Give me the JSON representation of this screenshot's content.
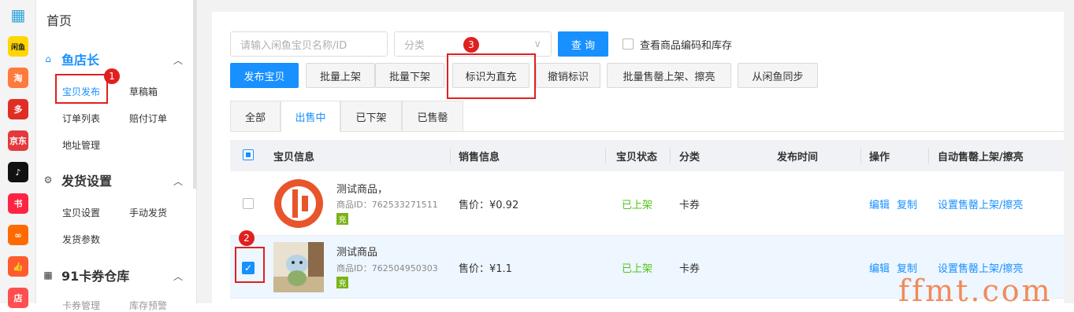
{
  "rail": {
    "icons": [
      {
        "name": "apps-grid-icon",
        "text": "",
        "color": "#2fa4d8"
      },
      {
        "name": "xianyu-icon",
        "text": "闲鱼",
        "color": "#ffd600"
      },
      {
        "name": "taobao-icon",
        "text": "淘",
        "color": "#ff7a3d"
      },
      {
        "name": "pinduoduo-icon",
        "text": "多",
        "color": "#e02e24"
      },
      {
        "name": "jingdong-icon",
        "text": "京东",
        "color": "#e4393c"
      },
      {
        "name": "douyin-icon",
        "text": "♪",
        "color": "#111111"
      },
      {
        "name": "xiaohongshu-icon",
        "text": "书",
        "color": "#ff2442"
      },
      {
        "name": "kuaishou-icon",
        "text": "∞",
        "color": "#ff6a00"
      },
      {
        "name": "thumb-icon",
        "text": "👍",
        "color": "#ff5b2e"
      },
      {
        "name": "store-icon",
        "text": "店",
        "color": "#ff4f4f"
      }
    ]
  },
  "nav": {
    "home": "首页",
    "sec1": {
      "title": "鱼店长",
      "items": [
        "宝贝发布",
        "草稿箱",
        "订单列表",
        "赔付订单",
        "地址管理"
      ]
    },
    "sec2": {
      "title": "发货设置",
      "items": [
        "宝贝设置",
        "手动发货",
        "发货参数"
      ]
    },
    "sec3": {
      "title": "91卡券仓库",
      "items": [
        "卡券管理",
        "库存预警"
      ]
    }
  },
  "search": {
    "placeholder": "请输入闲鱼宝贝名称/ID",
    "category_placeholder": "分类",
    "query_button": "查 询",
    "show_code_stock": "查看商品编码和库存"
  },
  "actions": {
    "publish": "发布宝贝",
    "bulk_on": "批量上架",
    "bulk_off": "批量下架",
    "mark_direct": "标识为直充",
    "unmark": "撤销标识",
    "bulk_soldout": "批量售罄上架、擦亮",
    "sync": "从闲鱼同步"
  },
  "tabs": [
    "全部",
    "出售中",
    "已下架",
    "已售罄"
  ],
  "table": {
    "headers": [
      "宝贝信息",
      "销售信息",
      "宝贝状态",
      "分类",
      "发布时间",
      "操作",
      "自动售罄上架/擦亮"
    ],
    "rows": [
      {
        "title": "测试商品，",
        "id": "商品ID：762533271511",
        "price": "售价：¥0.92",
        "status": "已上架",
        "category": "卡券",
        "time": "",
        "edit": "编辑",
        "copy": "复制",
        "auto": "设置售罄上架/擦亮",
        "tag": "充",
        "checked": false
      },
      {
        "title": "测试商品",
        "id": "商品ID：762504950303",
        "price": "售价：¥1.1",
        "status": "已上架",
        "category": "卡券",
        "time": "",
        "edit": "编辑",
        "copy": "复制",
        "auto": "设置售罄上架/擦亮",
        "tag": "充",
        "checked": true
      }
    ]
  },
  "annotations": {
    "b1": "1",
    "b2": "2",
    "b3": "3"
  },
  "watermark": "ffmt.com"
}
